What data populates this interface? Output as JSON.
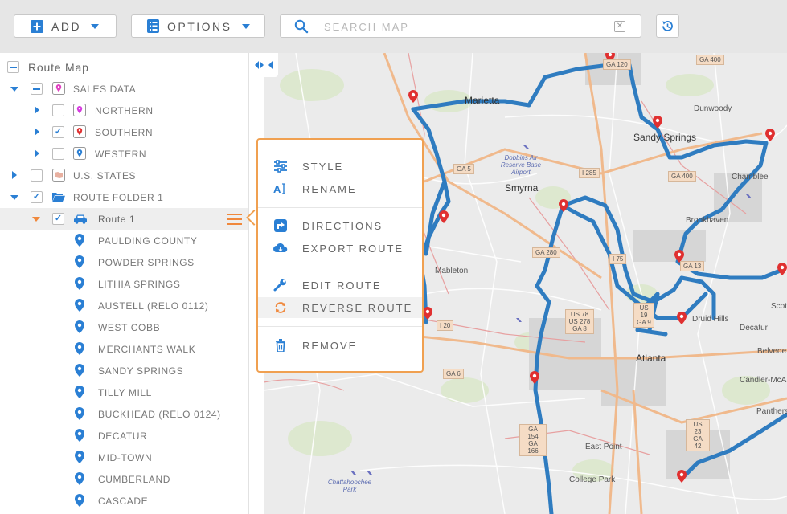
{
  "toolbar": {
    "add_label": "ADD",
    "options_label": "OPTIONS",
    "search_placeholder": "SEARCH MAP"
  },
  "sidebar": {
    "title": "Route Map",
    "sales_data": {
      "label": "SALES DATA",
      "children": [
        {
          "label": "NORTHERN",
          "checked": false
        },
        {
          "label": "SOUTHERN",
          "checked": true
        },
        {
          "label": "WESTERN",
          "checked": false
        }
      ]
    },
    "us_states": {
      "label": "U.S. STATES"
    },
    "route_folder": {
      "label": "ROUTE FOLDER 1"
    },
    "route": {
      "label": "Route 1"
    },
    "stops": [
      "PAULDING COUNTY",
      "POWDER SPRINGS",
      "LITHIA SPRINGS",
      "AUSTELL (RELO 0112)",
      "WEST COBB",
      "MERCHANTS WALK",
      "SANDY SPRINGS",
      "TILLY MILL",
      "BUCKHEAD (RELO 0124)",
      "DECATUR",
      "MID-TOWN",
      "CUMBERLAND",
      "CASCADE"
    ]
  },
  "context_menu": {
    "items": [
      {
        "label": "STYLE",
        "icon": "sliders-icon"
      },
      {
        "label": "RENAME",
        "icon": "rename-icon"
      },
      {
        "label": "DIRECTIONS",
        "icon": "directions-icon"
      },
      {
        "label": "EXPORT ROUTE",
        "icon": "cloud-download-icon"
      },
      {
        "label": "EDIT ROUTE",
        "icon": "wrench-icon"
      },
      {
        "label": "REVERSE ROUTE",
        "icon": "reverse-icon"
      },
      {
        "label": "REMOVE",
        "icon": "trash-icon"
      }
    ]
  },
  "map": {
    "cities": [
      "Marietta",
      "Sandy Springs",
      "Dunwoody",
      "Smyrna",
      "Chamblee",
      "Brookhaven",
      "Mableton",
      "Druid Hills",
      "Decatur",
      "Atlanta",
      "Scott",
      "Belvede",
      "Candler-McA",
      "Panthers",
      "East Point",
      "College Park"
    ],
    "parks": [
      "Dobbins Air Reserve Base Airport",
      "Chattahoochee Park"
    ],
    "shields": [
      "GA 5",
      "I 285",
      "GA 400",
      "GA 280",
      "I 20",
      "GA 6",
      "US 78 US 278 GA 8",
      "I 75",
      "US 19 GA 9",
      "GA 13",
      "US 23 GA 42",
      "GA 154 GA 166",
      "GA 400",
      "GA 120"
    ],
    "colors": {
      "route": "#2f7cc0",
      "pin": "#e03030",
      "accent": "#f0883c",
      "brand": "#2a7fd4"
    }
  }
}
